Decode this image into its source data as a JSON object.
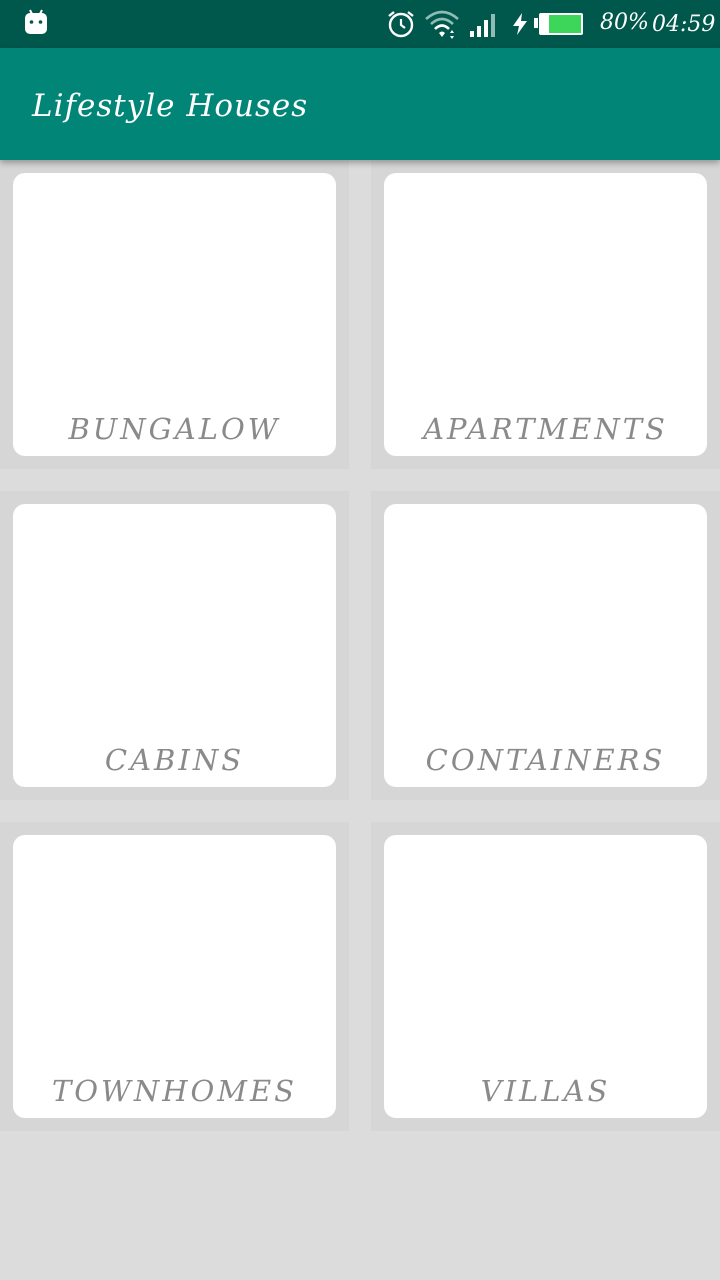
{
  "status_bar": {
    "battery_percent": "80%",
    "battery_level": 0.8,
    "time": "04:59",
    "icons": [
      "android-icon",
      "alarm-icon",
      "wifi-icon",
      "signal-icon",
      "charging-icon",
      "battery-icon"
    ]
  },
  "app_bar": {
    "title": "Lifestyle Houses",
    "color": "#008577"
  },
  "categories": [
    {
      "label": "BUNGALOW"
    },
    {
      "label": "APARTMENTS"
    },
    {
      "label": "CABINS"
    },
    {
      "label": "CONTAINERS"
    },
    {
      "label": "TOWNHOMES"
    },
    {
      "label": "VILLAS"
    }
  ]
}
